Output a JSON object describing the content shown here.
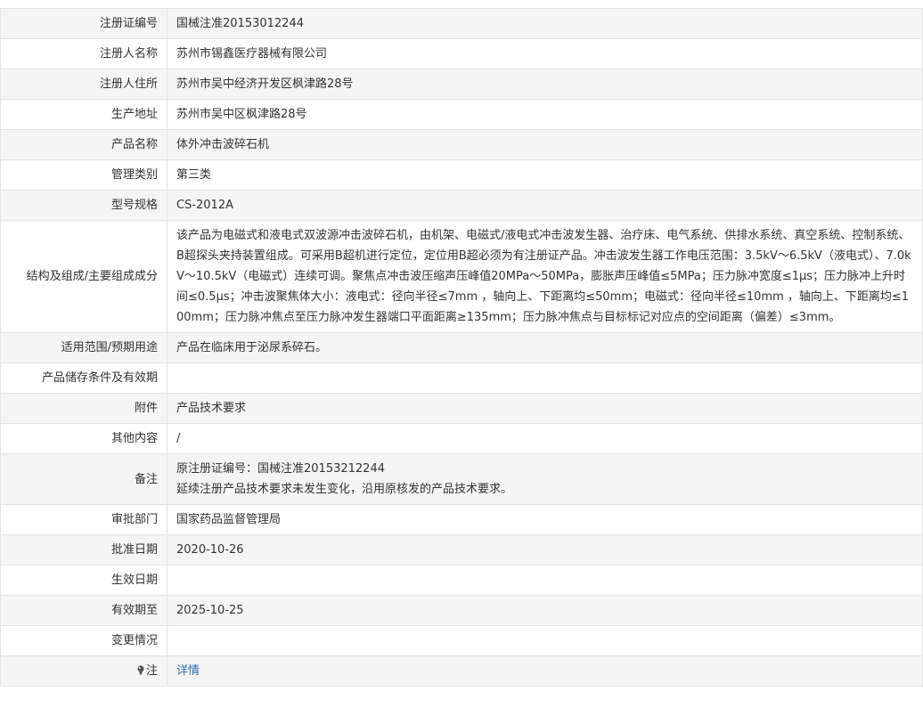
{
  "rows": [
    {
      "label": "注册证编号",
      "value": "国械注准20153012244"
    },
    {
      "label": "注册人名称",
      "value": "苏州市锡鑫医疗器械有限公司"
    },
    {
      "label": "注册人住所",
      "value": "苏州市吴中经济开发区枫津路28号"
    },
    {
      "label": "生产地址",
      "value": "苏州市吴中区枫津路28号"
    },
    {
      "label": "产品名称",
      "value": "体外冲击波碎石机"
    },
    {
      "label": "管理类别",
      "value": "第三类"
    },
    {
      "label": "型号规格",
      "value": "CS-2012A"
    },
    {
      "label": "结构及组成/主要组成成分",
      "value": "该产品为电磁式和液电式双波源冲击波碎石机，由机架、电磁式/液电式冲击波发生器、治疗床、电气系统、供排水系统、真空系统、控制系统、B超探头夹持装置组成。可采用B超机进行定位，定位用B超必须为有注册证产品。冲击波发生器工作电压范围：3.5kV～6.5kV（液电式）、7.0kV～10.5kV（电磁式）连续可调。聚焦点冲击波压缩声压峰值20MPa～50MPa，膨胀声压峰值≤5MPa；压力脉冲宽度≤1μs；压力脉冲上升时间≤0.5μs；冲击波聚焦体大小：液电式：径向半径≤7mm ，轴向上、下距离均≤50mm；电磁式：径向半径≤10mm ，轴向上、下距离均≤100mm；压力脉冲焦点至压力脉冲发生器端口平面距离≥135mm；压力脉冲焦点与目标标记对应点的空间距离（偏差）≤3mm。"
    },
    {
      "label": "适用范围/预期用途",
      "value": "产品在临床用于泌尿系碎石。"
    },
    {
      "label": "产品储存条件及有效期",
      "value": ""
    },
    {
      "label": "附件",
      "value": "产品技术要求"
    },
    {
      "label": "其他内容",
      "value": "/"
    },
    {
      "label": "备注",
      "lines": [
        "原注册证编号：国械注准20153212244",
        "延续注册产品技术要求未发生变化，沿用原核发的产品技术要求。"
      ]
    },
    {
      "label": "审批部门",
      "value": "国家药品监督管理局"
    },
    {
      "label": "批准日期",
      "value": "2020-10-26"
    },
    {
      "label": "生效日期",
      "value": ""
    },
    {
      "label": "有效期至",
      "value": "2025-10-25"
    },
    {
      "label": "变更情况",
      "value": ""
    }
  ],
  "note": {
    "label": "注",
    "icon": "lightbulb-icon",
    "link_text": "详情"
  },
  "colors": {
    "row_alt": "#f5f5f5",
    "border": "#e3e3e3",
    "link": "#2b6fb6"
  }
}
